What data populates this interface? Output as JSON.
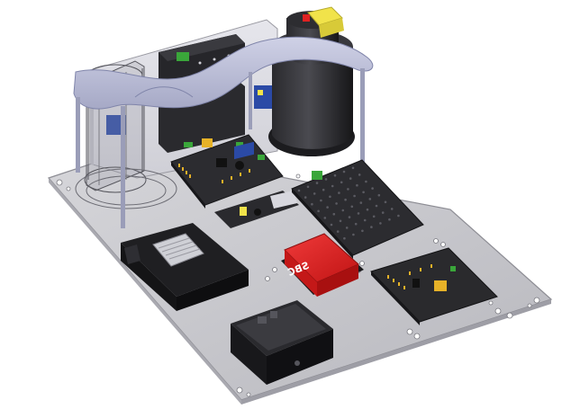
{
  "scene": {
    "kind": "3d-cad-render",
    "board_label": "SBC",
    "colors": {
      "background": "#ffffff",
      "base_plate": "#c9c9ce",
      "base_plate_edge": "#9a9aa2",
      "backplate": "#d7d7de",
      "frame": "#b9bcd6",
      "dark_part": "#1f1f22",
      "pcb_dark": "#2a2a2d",
      "sbc_red": "#e02222",
      "connector_green": "#3aa63a",
      "yellow": "#f1e34a",
      "blue_module": "#2b4aa6",
      "gold": "#e7b228"
    }
  }
}
